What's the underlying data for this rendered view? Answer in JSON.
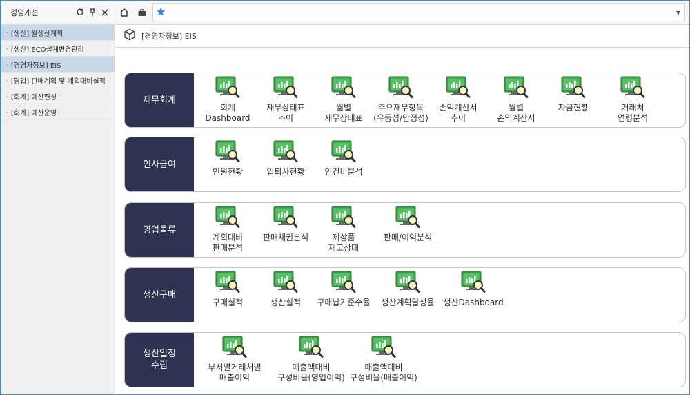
{
  "sidebar": {
    "title": "경영개선",
    "items": [
      {
        "label": "[생산] 월생산계획",
        "active": true
      },
      {
        "label": "[생산] ECO설계변경관리",
        "active": false
      },
      {
        "label": "[경영자정보] EIS",
        "active": true
      },
      {
        "label": "[영업] 판매계획 및 계획대비실적",
        "active": false
      },
      {
        "label": "[회계] 예산편성",
        "active": false
      },
      {
        "label": "[회계] 예산운영",
        "active": false
      }
    ]
  },
  "topbar": {
    "address_value": ""
  },
  "page": {
    "title": "[경영자정보] EIS"
  },
  "colors": {
    "label_bg": "#2e3352",
    "accent_blue": "#3b8fd6",
    "icon_green": "#3aa14a"
  },
  "sections": [
    {
      "label": "재무회계",
      "tiles": [
        "회계\nDashboard",
        "재무상태표\n추이",
        "월별\n재무상태표",
        "주요재무항목\n(유동성/안정성)",
        "손익계산서\n추이",
        "월별\n손익계산서",
        "자금현황",
        "거래처\n연령분석"
      ]
    },
    {
      "label": "인사급여",
      "tiles": [
        "인원현황",
        "입퇴사현황",
        "인건비분석"
      ]
    },
    {
      "label": "영업물류",
      "tiles": [
        "계획대비\n판매분석",
        "판매채권분석",
        "제상품\n재고상태",
        "판매/이익분석"
      ]
    },
    {
      "label": "생산구매",
      "tiles": [
        "구매실적",
        "생산실적",
        "구매납기준수율",
        "생산계획달성율",
        "생산Dashboard"
      ]
    },
    {
      "label": "생산일정\n수립",
      "tiles": [
        "부서별거래처별\n매출이익",
        "매출액대비\n구성비율(영업이익)",
        "매출액대비\n구성비율(매출이익)"
      ]
    }
  ]
}
